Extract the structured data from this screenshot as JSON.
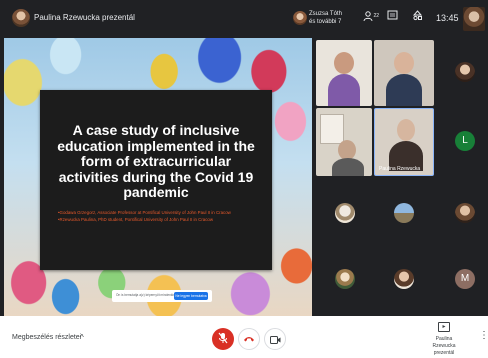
{
  "topbar": {
    "presenter_text": "Paulina Rzewucka prezentál",
    "people_text": "Zsuzsa Tóth és további 7",
    "participants_badge": "22",
    "clock": "13:45",
    "icons": [
      "people-icon",
      "chat-icon",
      "activities-icon"
    ]
  },
  "slide": {
    "title": "A case study of inclusive education implemented in the form of extracurricular activities during the Covid 19 pandemic",
    "author_1": "•Godawa Grzegorz, Associate Professor at Pontifical University of John Paul II in Cracow",
    "author_2": "•Rzewucka Paulina, PhD student, Pontifical University of John Paul II in Cracow"
  },
  "share_bar": {
    "message": "Ön is bemutatja a(z) képernyőt mindenkinek",
    "stop_label": "Ne legyen bemutatva"
  },
  "participants": {
    "featured_name": "Paulina Rzewucka",
    "letter_l": "L",
    "letter_m": "M"
  },
  "bottombar": {
    "details_label": "Megbeszélés részletei",
    "present_label": "Paulina Rzewucka prezentál"
  },
  "colors": {
    "mic_off": "#d93025",
    "hangup": "#d93025",
    "stop_button": "#1a73e8",
    "author_text": "#e8592b",
    "avatar_l": "#188038",
    "avatar_m": "#8d6e63"
  }
}
